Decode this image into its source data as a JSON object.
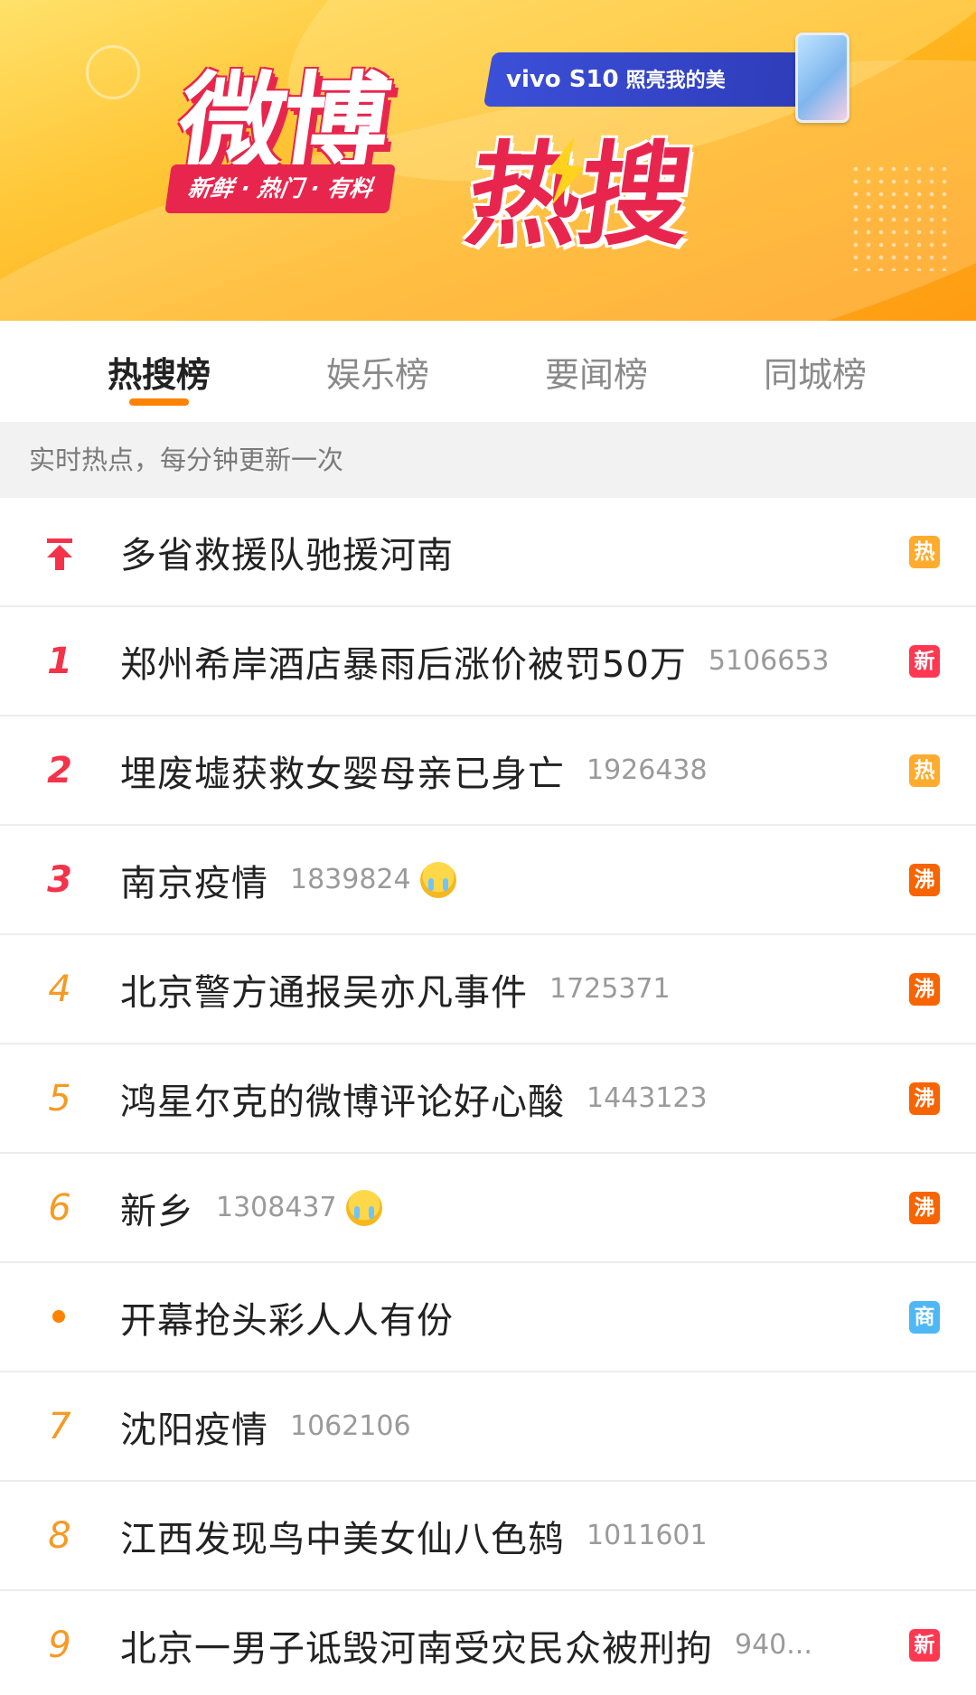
{
  "banner": {
    "logo_main": "微博",
    "logo_sub": "热搜",
    "tagline": "新鲜 · 热门 · 有料",
    "ad_brand": "vivo S10",
    "ad_slogan": "照亮我的美"
  },
  "tabs": [
    {
      "label": "热搜榜",
      "active": true
    },
    {
      "label": "娱乐榜",
      "active": false
    },
    {
      "label": "要闻榜",
      "active": false
    },
    {
      "label": "同城榜",
      "active": false
    }
  ],
  "subheader": "实时热点，每分钟更新一次",
  "items": [
    {
      "rank": "",
      "rank_type": "top",
      "title": "多省救援队驰援河南",
      "count": "",
      "emoji": false,
      "badge": "热",
      "badge_type": "hot"
    },
    {
      "rank": "1",
      "rank_type": "red",
      "title": "郑州希岸酒店暴雨后涨价被罚50万",
      "count": "5106653",
      "emoji": false,
      "badge": "新",
      "badge_type": "new"
    },
    {
      "rank": "2",
      "rank_type": "red",
      "title": "埋废墟获救女婴母亲已身亡",
      "count": "1926438",
      "emoji": false,
      "badge": "热",
      "badge_type": "hot"
    },
    {
      "rank": "3",
      "rank_type": "red",
      "title": "南京疫情",
      "count": "1839824",
      "emoji": true,
      "badge": "沸",
      "badge_type": "boil"
    },
    {
      "rank": "4",
      "rank_type": "orange",
      "title": "北京警方通报吴亦凡事件",
      "count": "1725371",
      "emoji": false,
      "badge": "沸",
      "badge_type": "boil"
    },
    {
      "rank": "5",
      "rank_type": "orange",
      "title": "鸿星尔克的微博评论好心酸",
      "count": "1443123",
      "emoji": false,
      "badge": "沸",
      "badge_type": "boil"
    },
    {
      "rank": "6",
      "rank_type": "orange",
      "title": "新乡",
      "count": "1308437",
      "emoji": true,
      "badge": "沸",
      "badge_type": "boil"
    },
    {
      "rank": "",
      "rank_type": "dot",
      "title": "开幕抢头彩人人有份",
      "count": "",
      "emoji": false,
      "badge": "商",
      "badge_type": "ad"
    },
    {
      "rank": "7",
      "rank_type": "orange",
      "title": "沈阳疫情",
      "count": "1062106",
      "emoji": false,
      "badge": "",
      "badge_type": ""
    },
    {
      "rank": "8",
      "rank_type": "orange",
      "title": "江西发现鸟中美女仙八色鸫",
      "count": "1011601",
      "emoji": false,
      "badge": "",
      "badge_type": ""
    },
    {
      "rank": "9",
      "rank_type": "orange",
      "title": "北京一男子诋毁河南受灾民众被刑拘",
      "count": "940...",
      "emoji": false,
      "badge": "新",
      "badge_type": "new"
    }
  ],
  "colors": {
    "accent": "#ff8200",
    "rank_red": "#f4334a",
    "rank_orange": "#f59a23",
    "badge_hot": "#ffab2d",
    "badge_new": "#ff3852",
    "badge_boil": "#f86400",
    "badge_ad": "#4eb7f5"
  },
  "icons": {
    "top_rank": "pin-to-top-arrow-icon",
    "sponsored": "orange-dot-icon",
    "emoji": "crying-face-emoji-icon"
  }
}
